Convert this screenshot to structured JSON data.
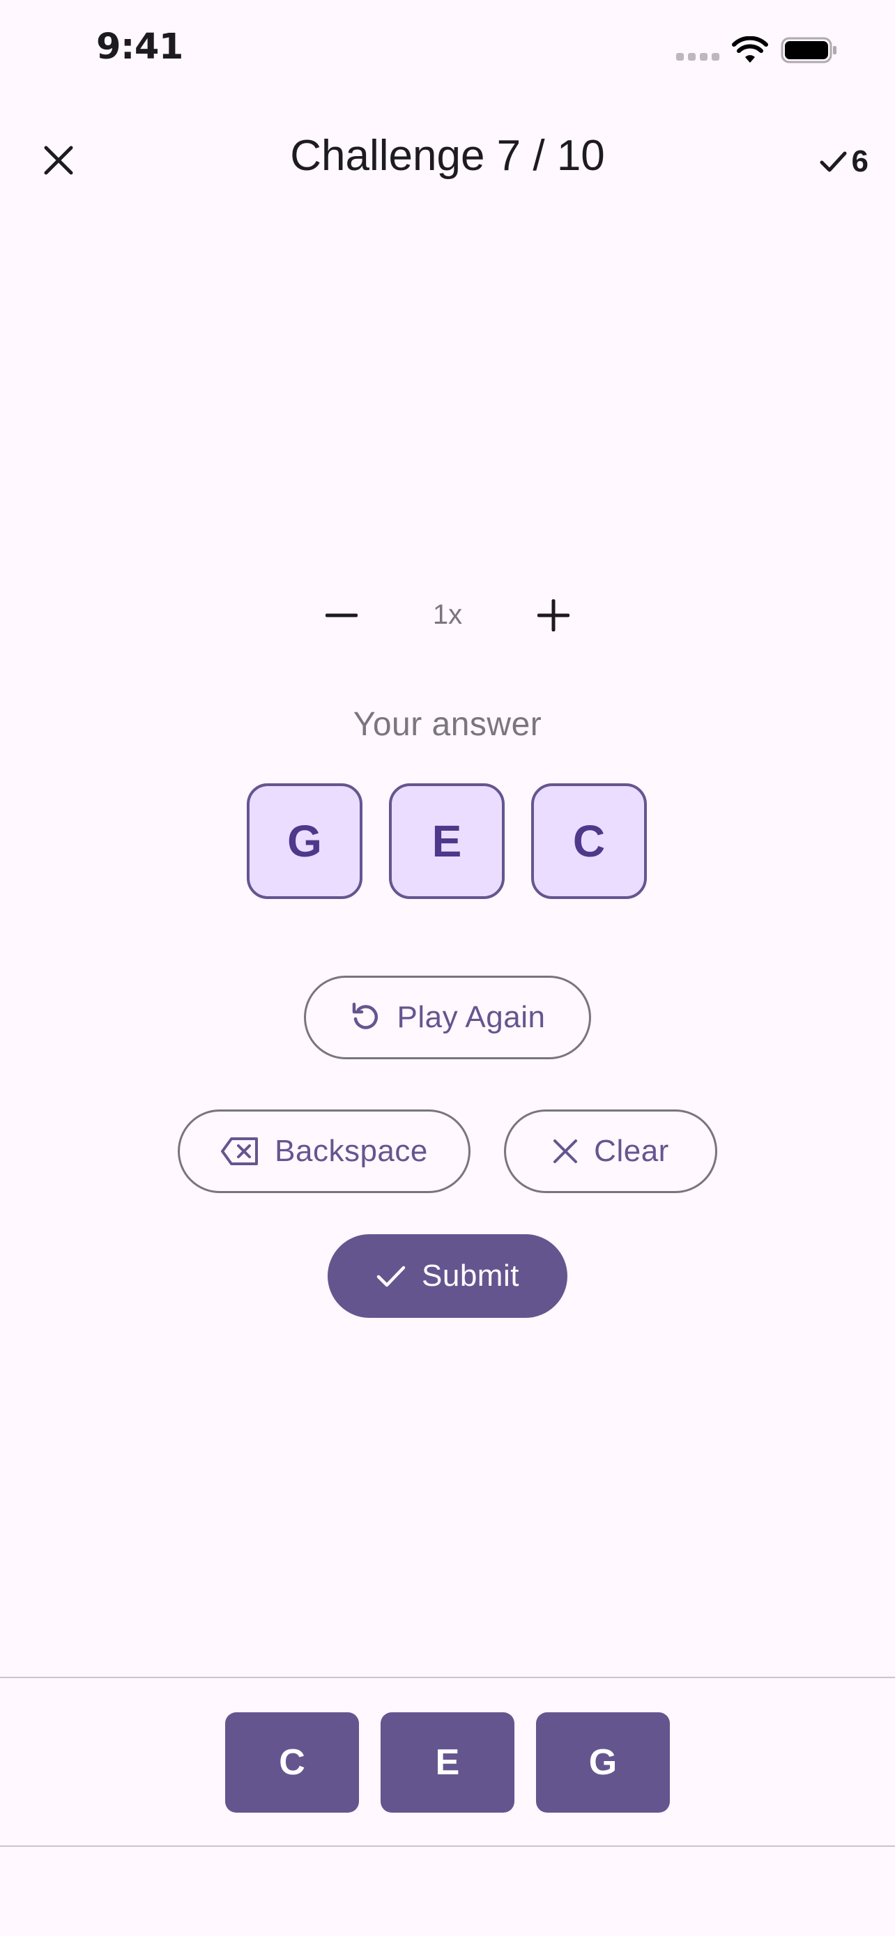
{
  "status_bar": {
    "time": "9:41",
    "icons": [
      "signal-icon",
      "wifi-icon",
      "battery-icon"
    ]
  },
  "header": {
    "close_icon": "close-icon",
    "title": "Challenge 7 / 10",
    "score_icon": "check-icon",
    "score": "6"
  },
  "speed": {
    "decrease_icon": "minus-icon",
    "value": "1x",
    "increase_icon": "plus-icon"
  },
  "answer": {
    "label": "Your answer",
    "slots": [
      "G",
      "E",
      "C"
    ]
  },
  "actions": {
    "play_again": {
      "label": "Play Again",
      "icon": "replay-icon"
    },
    "backspace": {
      "label": "Backspace",
      "icon": "backspace-icon"
    },
    "clear": {
      "label": "Clear",
      "icon": "close-icon"
    },
    "submit": {
      "label": "Submit",
      "icon": "check-icon"
    }
  },
  "note_keys": [
    "C",
    "E",
    "G"
  ],
  "colors": {
    "background": "#FFF8FE",
    "primary": "#65558F",
    "primary_container": "#EADDFF",
    "on_primary_container": "#4F378A",
    "outline": "#79747E",
    "muted_text": "#7A757F",
    "divider": "#CAC4D0"
  }
}
